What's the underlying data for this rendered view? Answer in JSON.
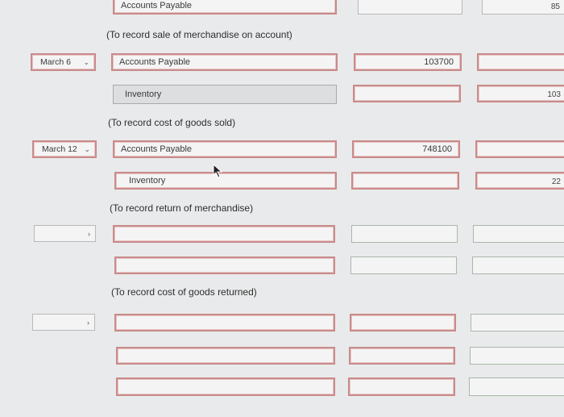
{
  "rows": {
    "r0": {
      "account": "Accounts Payable",
      "credit_partial": "85"
    },
    "note_sale": "(To record sale of merchandise on account)",
    "r1": {
      "date": "March 6",
      "account": "Accounts Payable",
      "debit": "103700"
    },
    "r2": {
      "account": "Inventory",
      "credit_partial": "103"
    },
    "note_cost": "(To record cost of goods sold)",
    "r3": {
      "date": "March 12",
      "account": "Accounts Payable",
      "debit": "748100"
    },
    "r4": {
      "account": "Inventory",
      "credit_partial": "22"
    },
    "note_return": "(To record return of merchandise)",
    "note_cost_returned": "(To record cost of goods returned)"
  },
  "icons": {
    "dropdown": "chevron-down-icon",
    "cursor": "mouse-pointer-icon"
  }
}
